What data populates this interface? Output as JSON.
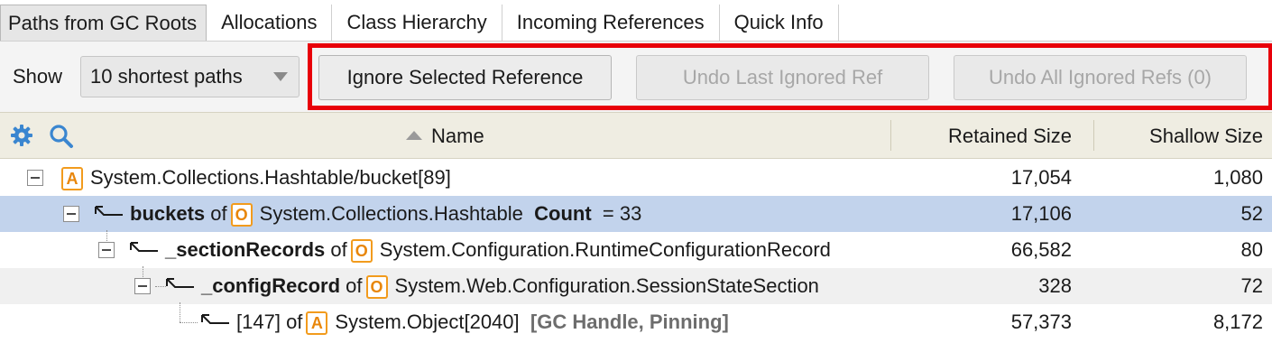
{
  "tabs": [
    {
      "label": "Paths from GC Roots"
    },
    {
      "label": "Allocations"
    },
    {
      "label": "Class Hierarchy"
    },
    {
      "label": "Incoming References"
    },
    {
      "label": "Quick Info"
    }
  ],
  "toolbar": {
    "show_label": "Show",
    "show_select_value": "10 shortest paths",
    "ignore_button": "Ignore Selected Reference",
    "undo_last_button": "Undo Last Ignored Ref",
    "undo_all_button": "Undo All Ignored Refs (0)"
  },
  "columns": {
    "name": "Name",
    "retained": "Retained Size",
    "shallow": "Shallow Size"
  },
  "colors": {
    "highlight_box": "#e8000a",
    "selected_row": "#c2d3ec",
    "badge_orange": "#f29b1d"
  },
  "icons": [
    "settings-gear-icon",
    "search-icon",
    "sort-ascending-icon",
    "reference-arrow-icon",
    "collapse-icon"
  ],
  "rows": [
    {
      "badge": "A",
      "field": "",
      "of": "",
      "type": "System.Collections.Hashtable/bucket[89]",
      "extra_label": "",
      "extra_value": "",
      "root_info": "",
      "retained": "17,054",
      "shallow": "1,080"
    },
    {
      "badge": "O",
      "field": "buckets",
      "of": "of",
      "type": "System.Collections.Hashtable",
      "extra_label": "Count",
      "extra_value": "= 33",
      "root_info": "",
      "retained": "17,106",
      "shallow": "52"
    },
    {
      "badge": "O",
      "field": "_sectionRecords",
      "of": "of",
      "type": "System.Configuration.RuntimeConfigurationRecord",
      "extra_label": "",
      "extra_value": "",
      "root_info": "",
      "retained": "66,582",
      "shallow": "80"
    },
    {
      "badge": "O",
      "field": "_configRecord",
      "of": "of",
      "type": "System.Web.Configuration.SessionStateSection",
      "extra_label": "",
      "extra_value": "",
      "root_info": "",
      "retained": "328",
      "shallow": "72"
    },
    {
      "badge": "A",
      "field": "[147]",
      "of": "of",
      "type": "System.Object[2040]",
      "extra_label": "",
      "extra_value": "",
      "root_info": "[GC Handle, Pinning]",
      "retained": "57,373",
      "shallow": "8,172"
    }
  ]
}
